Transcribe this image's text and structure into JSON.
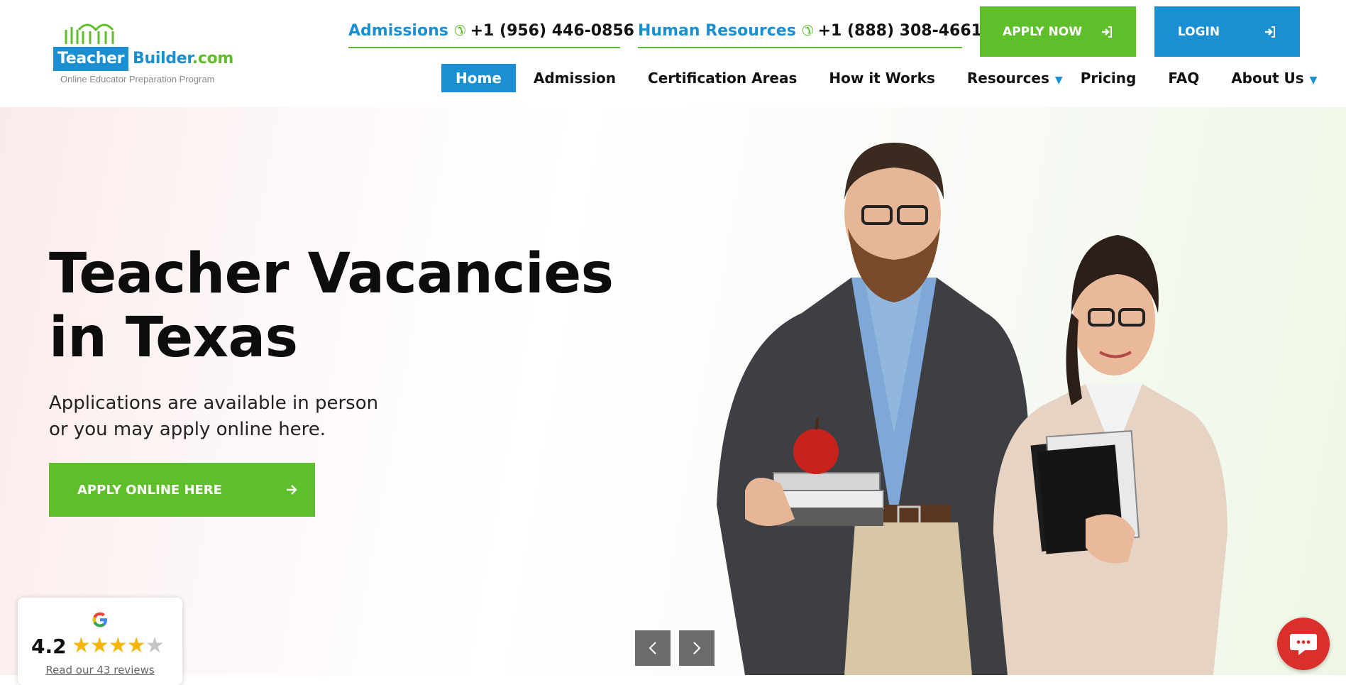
{
  "logo": {
    "name_part1": "Teacher",
    "name_part2": "Builder",
    "name_part3": ".com",
    "tagline": "Online Educator Preparation Program"
  },
  "contacts": [
    {
      "label": "Admissions",
      "phone": "+1 (956) 446-0856"
    },
    {
      "label": "Human Resources",
      "phone": "+1 (888) 308-4661"
    }
  ],
  "buttons": {
    "apply_now": "APPLY NOW",
    "login": "LOGIN"
  },
  "nav": {
    "items": [
      {
        "label": "Home",
        "active": true
      },
      {
        "label": "Admission"
      },
      {
        "label": "Certification Areas"
      },
      {
        "label": "How it Works"
      },
      {
        "label": "Resources",
        "dropdown": true
      },
      {
        "label": "Pricing"
      },
      {
        "label": "FAQ"
      },
      {
        "label": "About Us",
        "dropdown": true
      }
    ]
  },
  "hero": {
    "title_line1": "Teacher Vacancies",
    "title_line2": "in Texas",
    "subtitle_line1": "Applications are available in person",
    "subtitle_line2": "or you may apply online here.",
    "cta": "APPLY ONLINE HERE"
  },
  "review_widget": {
    "rating": "4.2",
    "stars": 4.2,
    "link": "Read our 43 reviews"
  },
  "colors": {
    "green": "#5fbf2b",
    "blue": "#1a8fd1",
    "chat_red": "#d9302b"
  },
  "icons": [
    "phone-icon",
    "sign-in-icon",
    "arrow-right-icon",
    "chevron-left-icon",
    "chevron-right-icon",
    "google-icon",
    "chat-icon",
    "caret-down-icon"
  ]
}
